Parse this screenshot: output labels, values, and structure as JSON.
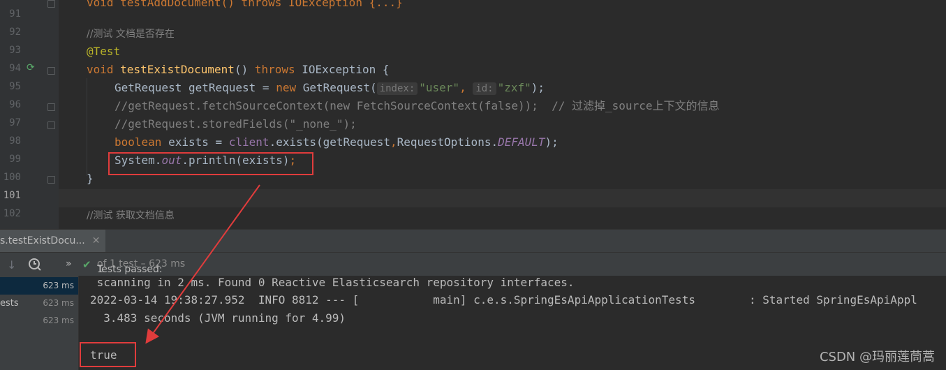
{
  "editor": {
    "lines": [
      {
        "num": "91",
        "html": ""
      },
      {
        "num": "92",
        "html": ""
      },
      {
        "num": "93",
        "html": ""
      },
      {
        "num": "94",
        "html": ""
      },
      {
        "num": "95",
        "html": ""
      },
      {
        "num": "96",
        "html": ""
      },
      {
        "num": "97",
        "html": ""
      },
      {
        "num": "98",
        "html": ""
      },
      {
        "num": "99",
        "html": ""
      },
      {
        "num": "100",
        "html": ""
      },
      {
        "num": "101",
        "html": ""
      },
      {
        "num": "102",
        "html": ""
      }
    ],
    "top_partial": "void testAddDocument() throws IOException {...}",
    "comment_exist": "//测试 文档是否存在",
    "annotation": "@Test",
    "sig_void": "void",
    "sig_name": "testExistDocument",
    "sig_paren": "()",
    "sig_throws": "throws",
    "sig_exc": "IOException {",
    "l95_type": "GetRequest getRequest = ",
    "l95_new": "new",
    "l95_ctor": " GetRequest(",
    "l95_hint1": "index:",
    "l95_str1": "\"user\"",
    "l95_comma": ", ",
    "l95_hint2": "id:",
    "l95_str2": "\"zxf\"",
    "l95_end": ");",
    "l96": "//getRequest.fetchSourceContext(new FetchSourceContext(false));  // 过滤掉_source上下文的信息",
    "l97": "//getRequest.storedFields(\"_none_\");",
    "l98_kw": "boolean",
    "l98_mid": " exists = ",
    "l98_client": "client",
    "l98_call": ".exists(getRequest",
    "l98_comma": ",",
    "l98_opts": "RequestOptions.",
    "l98_default": "DEFAULT",
    "l98_end": ");",
    "l99_sys": "System.",
    "l99_out": "out",
    "l99_rest": ".println(exists)",
    "l99_semi": ";",
    "l100": "}",
    "l102": "//测试 获取文档信息"
  },
  "run": {
    "tab_label": "s.testExistDocu...",
    "tab_close": "✕",
    "tests_passed_label": "Tests passed: ",
    "tests_passed_count": "1",
    "tests_passed_rest": " of 1 test – 623 ms",
    "tree": [
      {
        "label": "",
        "time": "623 ms",
        "selected": true
      },
      {
        "label": "ests",
        "time": "623 ms",
        "selected": false
      },
      {
        "label": "",
        "time": "623 ms",
        "selected": false
      }
    ],
    "console": [
      " scanning in 2 ms. Found 0 Reactive Elasticsearch repository interfaces.",
      "2022-03-14 19:38:27.952  INFO 8812 --- [           main] c.e.s.SpringEsApiApplicationTests        : Started SpringEsApiAppl",
      "  3.483 seconds (JVM running for 4.99)",
      "",
      "true"
    ]
  },
  "watermark": "CSDN @玛丽莲茼蒿",
  "colors": {
    "highlight_box": "#e03c3c",
    "pass_check": "#59a869"
  }
}
